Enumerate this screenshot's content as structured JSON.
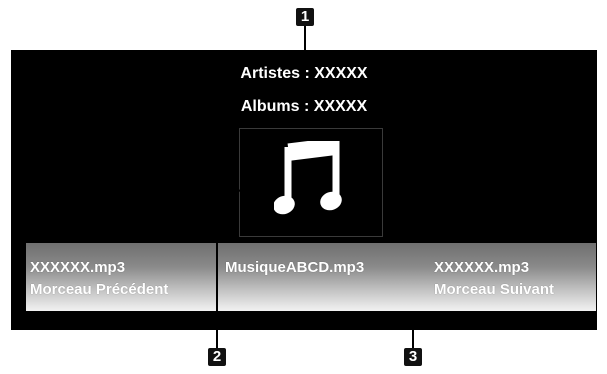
{
  "callouts": {
    "top": "1",
    "left": "2",
    "right": "3"
  },
  "info": {
    "artists": "Artistes : XXXXX",
    "albums": "Albums : XXXXX"
  },
  "album_art": {
    "icon": "music-note-icon"
  },
  "track_bar": {
    "previous_file": "XXXXXX.mp3",
    "previous_label": "Morceau Précédent",
    "current_file": "MusiqueABCD.mp3",
    "next_file": "XXXXXX.mp3",
    "next_label": "Morceau Suivant"
  }
}
